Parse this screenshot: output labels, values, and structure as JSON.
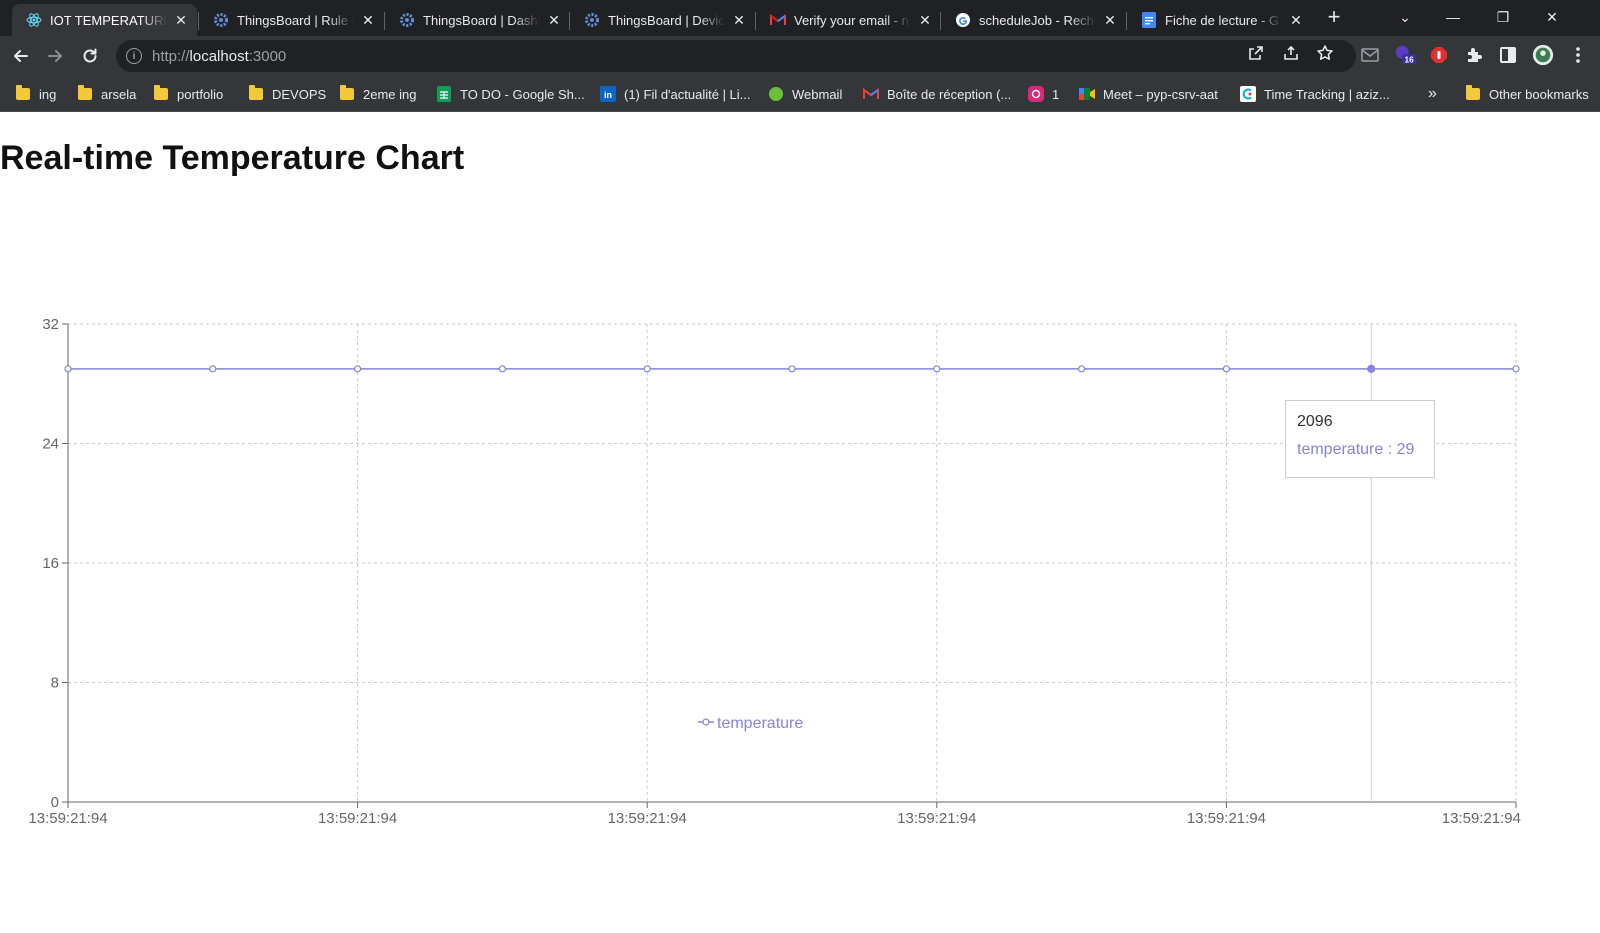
{
  "browser": {
    "tabs": [
      {
        "title": "IOT TEMPERATURE S",
        "icon": "react-icon",
        "active": true
      },
      {
        "title": "ThingsBoard | Rule c",
        "icon": "thingsboard-icon",
        "active": false
      },
      {
        "title": "ThingsBoard | Dashb",
        "icon": "thingsboard-icon",
        "active": false
      },
      {
        "title": "ThingsBoard | Devic",
        "icon": "thingsboard-icon",
        "active": false
      },
      {
        "title": "Verify your email - n",
        "icon": "gmail-icon",
        "active": false
      },
      {
        "title": "scheduleJob - Reche",
        "icon": "google-icon",
        "active": false
      },
      {
        "title": "Fiche de lecture - G",
        "icon": "docs-icon",
        "active": false
      }
    ],
    "url_scheme": "http://",
    "url_host": "localhost",
    "url_port": ":3000",
    "extension_badge": "16",
    "bookmarks": [
      {
        "label": "ing",
        "icon": "folder-icon"
      },
      {
        "label": "arsela",
        "icon": "folder-icon"
      },
      {
        "label": "portfolio",
        "icon": "folder-icon"
      },
      {
        "label": "DEVOPS",
        "icon": "folder-icon"
      },
      {
        "label": "2eme ing",
        "icon": "folder-icon"
      },
      {
        "label": "TO DO - Google Sh...",
        "icon": "sheets-icon"
      },
      {
        "label": "(1) Fil d'actualité | Li...",
        "icon": "linkedin-icon"
      },
      {
        "label": "Webmail",
        "icon": "webmail-icon"
      },
      {
        "label": "Boîte de réception (...",
        "icon": "gmail-icon"
      },
      {
        "label": "1",
        "icon": "instagram-icon"
      },
      {
        "label": "Meet – pyp-csrv-aat",
        "icon": "meet-icon"
      },
      {
        "label": "Time Tracking | aziz...",
        "icon": "clockify-icon"
      }
    ],
    "bookmarks_overflow": "»",
    "other_bookmarks": "Other bookmarks"
  },
  "page": {
    "title": "Real-time Temperature Chart"
  },
  "tooltip": {
    "label": "2096",
    "series_name": "temperature",
    "value": "29"
  },
  "colors": {
    "series": "#8884d8",
    "grid": "#cccccc",
    "axis": "#666666"
  },
  "chart_data": {
    "type": "line",
    "title": "",
    "xlabel": "",
    "ylabel": "",
    "x_tick_labels": [
      "13:59:21:94",
      "13:59:21:94",
      "13:59:21:94",
      "13:59:21:94",
      "13:59:21:94",
      "13:59:21:94"
    ],
    "y_ticks": [
      0,
      8,
      16,
      24,
      32
    ],
    "ylim": [
      0,
      32
    ],
    "series": [
      {
        "name": "temperature",
        "values": [
          29,
          29,
          29,
          29,
          29,
          29,
          29,
          29,
          29,
          29,
          29
        ]
      }
    ],
    "active_index": 9,
    "grid": true,
    "legend": "bottom"
  }
}
